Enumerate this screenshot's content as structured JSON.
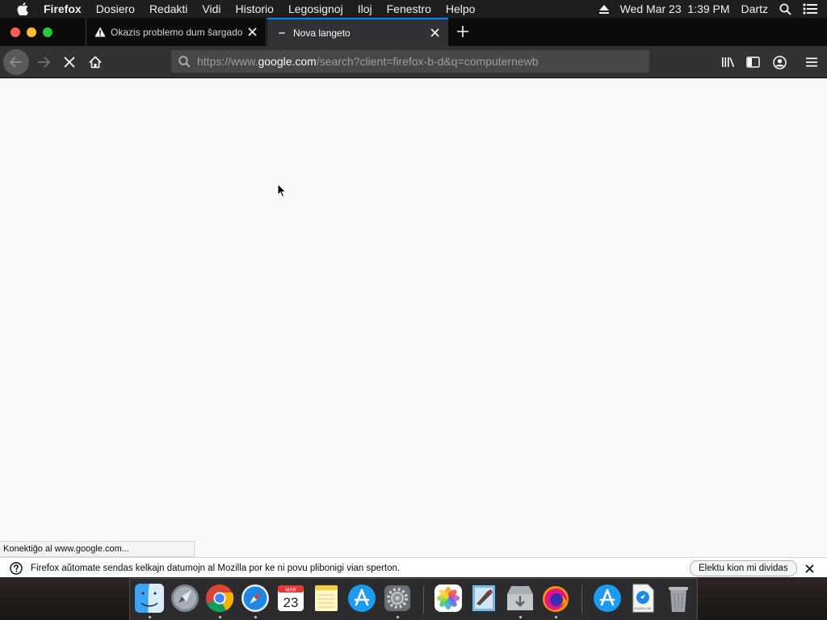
{
  "menubar": {
    "app_name": "Firefox",
    "items": [
      "Dosiero",
      "Redakti",
      "Vidi",
      "Historio",
      "Legosignoj",
      "Iloj",
      "Fenestro",
      "Helpo"
    ],
    "datetime": "Wed Mar 23  1:39 PM",
    "user": "Dartz"
  },
  "tabs": [
    {
      "label": "Okazis problemo dum ŝargado de paĝo",
      "icon": "warning-icon",
      "active": false
    },
    {
      "label": "Nova langeto",
      "icon": "loading-icon",
      "active": true
    }
  ],
  "urlbar": {
    "prefix": "https://www.",
    "host": "google.com",
    "path": "/search?client=firefox-b-d&q=computernewb"
  },
  "status_text": "Konektiĝo al www.google.com...",
  "notification": {
    "text": "Firefox aŭtomate sendas kelkajn datumojn al Mozilla por ke ni povu plibonigi vian sperton.",
    "button_label": "Elektu kion mi dividas"
  },
  "dock": {
    "calendar_month": "MAR",
    "calendar_day": "23",
    "download_label": "DOWNLOAD"
  },
  "colors": {
    "accent": "#0a84ff",
    "close": "#ff5f57",
    "minimize": "#febc2e",
    "zoom": "#28c840"
  }
}
